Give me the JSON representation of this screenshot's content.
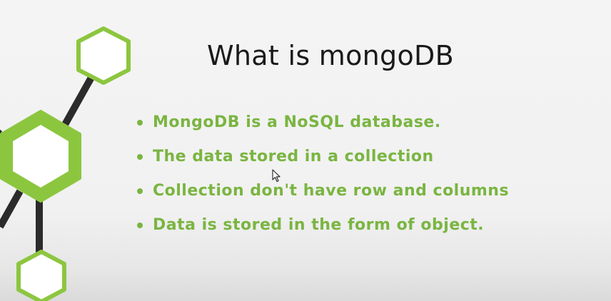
{
  "slide": {
    "title": "What is mongoDB",
    "bullets": [
      "MongoDB is a NoSQL database.",
      "The data stored in a collection",
      "Collection don't have row and columns",
      "Data is stored in the form of object."
    ]
  },
  "colors": {
    "accent_green": "#7ab541",
    "hex_fill_green": "#8cc63f",
    "connector": "#2b2b2b",
    "title_text": "#1a1a1a",
    "background": "#f1f1f1"
  },
  "icons": [
    "hexagon-node-icon",
    "mouse-cursor-icon"
  ]
}
